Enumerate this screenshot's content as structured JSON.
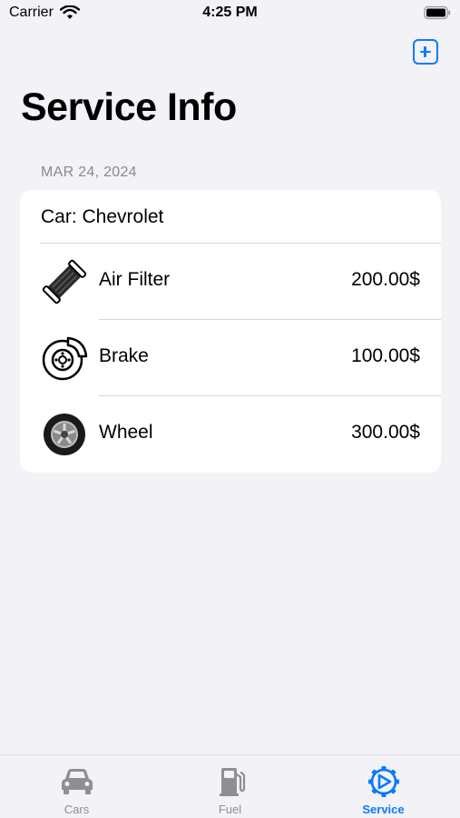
{
  "status_bar": {
    "carrier": "Carrier",
    "time": "4:25 PM"
  },
  "nav": {
    "title": "Service Info",
    "add_icon": "plus-square-icon"
  },
  "section": {
    "date": "MAR 24, 2024",
    "car_label": "Car: Chevrolet",
    "items": [
      {
        "name": "Air Filter",
        "price": "200.00$",
        "icon": "air-filter-icon"
      },
      {
        "name": "Brake",
        "price": "100.00$",
        "icon": "brake-disc-icon"
      },
      {
        "name": "Wheel",
        "price": "300.00$",
        "icon": "wheel-icon"
      }
    ]
  },
  "tabs": [
    {
      "label": "Cars",
      "icon": "car-icon",
      "active": false
    },
    {
      "label": "Fuel",
      "icon": "fuel-pump-icon",
      "active": false
    },
    {
      "label": "Service",
      "icon": "gear-wrench-icon",
      "active": true
    }
  ],
  "colors": {
    "accent": "#0a7aff",
    "background": "#f2f2f7",
    "inactive": "#8e8e93"
  }
}
